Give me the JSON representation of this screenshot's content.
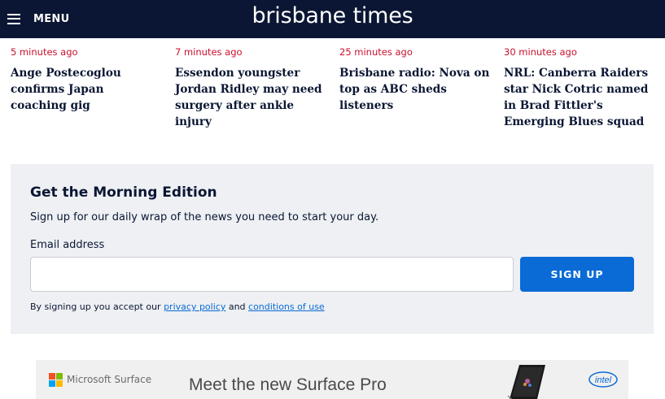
{
  "header": {
    "menu_label": "MENU",
    "logo_text": "brisbane times"
  },
  "stories": [
    {
      "time": "5 minutes ago",
      "title": "Ange Postecoglou confirms Japan coaching gig"
    },
    {
      "time": "7 minutes ago",
      "title": "Essendon youngster Jordan Ridley may need surgery after ankle injury"
    },
    {
      "time": "25 minutes ago",
      "title": "Brisbane radio: Nova on top as ABC sheds listeners"
    },
    {
      "time": "30 minutes ago",
      "title": "NRL: Canberra Raiders star Nick Cotric named in Brad Fittler's Emerging Blues squad"
    }
  ],
  "newsletter": {
    "heading": "Get the Morning Edition",
    "description": "Sign up for our daily wrap of the news you need to start your day.",
    "email_label": "Email address",
    "email_value": "",
    "email_placeholder": "",
    "button_label": "SIGN UP",
    "terms_prefix": "By signing up you accept our ",
    "privacy_link": "privacy policy",
    "terms_and": " and ",
    "conditions_link": "conditions of use"
  },
  "ad": {
    "brand": "Microsoft Surface",
    "headline": "Meet the new Surface Pro",
    "partner_logo": "intel"
  },
  "colors": {
    "header_bg": "#0a1633",
    "timestamp_red": "#c8102e",
    "accent_blue": "#0a6bd6",
    "panel_bg": "#eef0f3"
  },
  "icons": {
    "menu": "hamburger-icon",
    "ad_brand": "microsoft-logo-icon",
    "ad_device": "surface-device-image",
    "ad_partner": "intel-logo-icon"
  }
}
